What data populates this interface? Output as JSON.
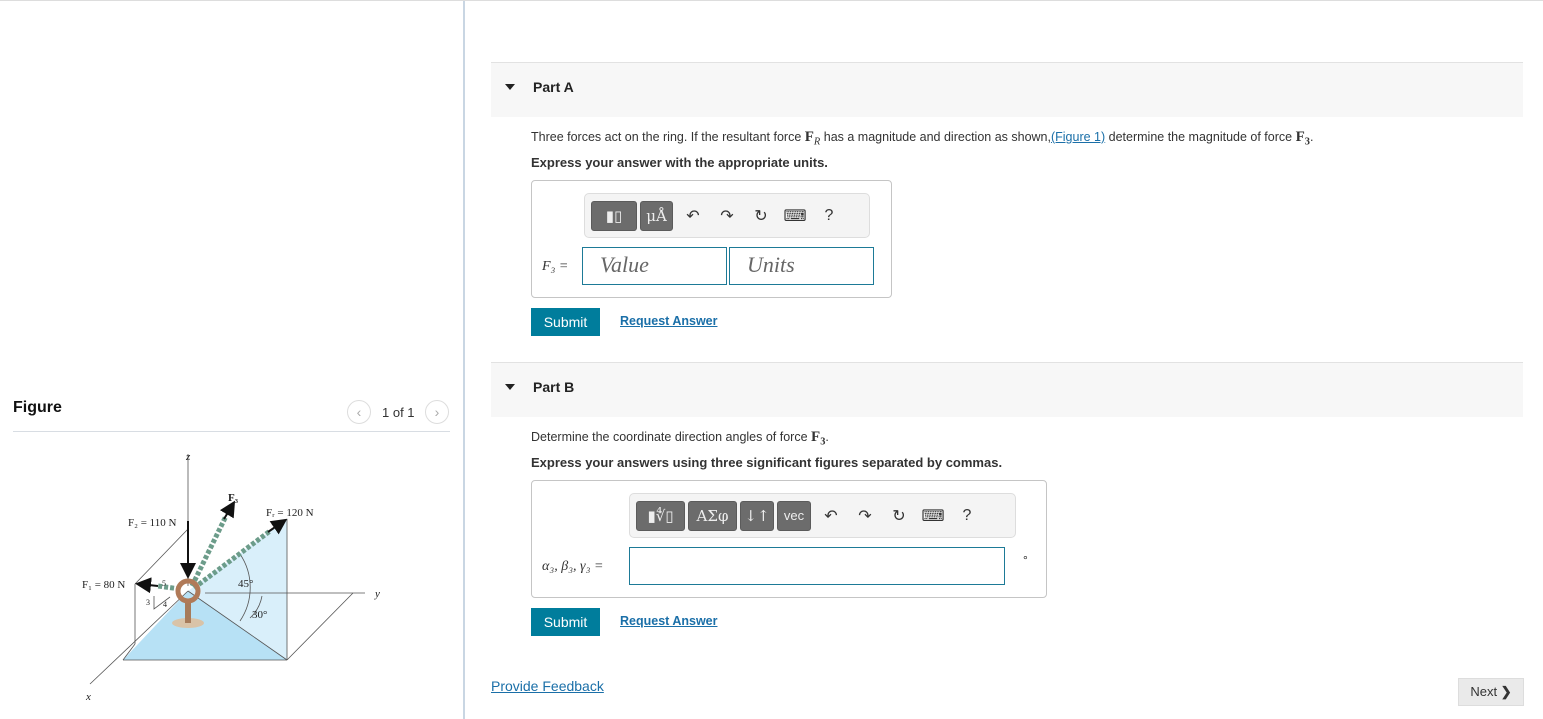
{
  "figure": {
    "title": "Figure",
    "pager": "1 of 1",
    "prev_icon": "chevron-left-icon",
    "next_icon": "chevron-right-icon",
    "labels": {
      "z": "z",
      "y": "y",
      "x": "x",
      "F1": "F₁ = 80 N",
      "F2": "F₂ = 110 N",
      "F3": "F₃",
      "FR": "Fᵣ = 120 N",
      "angle45": "45°",
      "angle30": "30°",
      "tri3": "3",
      "tri4": "4",
      "tri5": "5"
    },
    "colors": {
      "floor": "#b7e1f5",
      "wall": "#d9effa"
    }
  },
  "partA": {
    "label": "Part A",
    "text_before": "Three forces act on the ring. If the resultant force ",
    "fr_symbol": "F",
    "fr_sub": "R",
    "text_mid": " has a magnitude and direction as shown,",
    "figure_link": "(Figure 1)",
    "text_after": " determine the magnitude of force ",
    "f3_symbol": "F",
    "f3_sub": "3",
    "text_end": ".",
    "instruction": "Express your answer with the appropriate units.",
    "toolbar": {
      "templates": "▮▯",
      "units": "μÅ",
      "undo": "↶",
      "redo": "↷",
      "reset": "↻",
      "keyboard": "⌨",
      "help": "?"
    },
    "var_label": "F₃ =",
    "value_placeholder": "Value",
    "units_placeholder": "Units",
    "submit": "Submit",
    "request": "Request Answer"
  },
  "partB": {
    "label": "Part B",
    "text_before": "Determine the coordinate direction angles of force ",
    "f3_symbol": "F",
    "f3_sub": "3",
    "text_end": ".",
    "instruction": "Express your answers using three significant figures separated by commas.",
    "toolbar": {
      "templates": "▮∜▯",
      "greek": "ΑΣφ",
      "arrows": "↓↑",
      "vec": "vec",
      "undo": "↶",
      "redo": "↷",
      "reset": "↻",
      "keyboard": "⌨",
      "help": "?"
    },
    "var_label": "α₃, β₃, γ₃ =",
    "unit": "°",
    "submit": "Submit",
    "request": "Request Answer"
  },
  "footer": {
    "feedback": "Provide Feedback",
    "next": "Next",
    "next_icon": "❯"
  },
  "colors": {
    "accent": "#007d9c",
    "link": "#1a6fa8",
    "field_border": "#1d7a97"
  }
}
